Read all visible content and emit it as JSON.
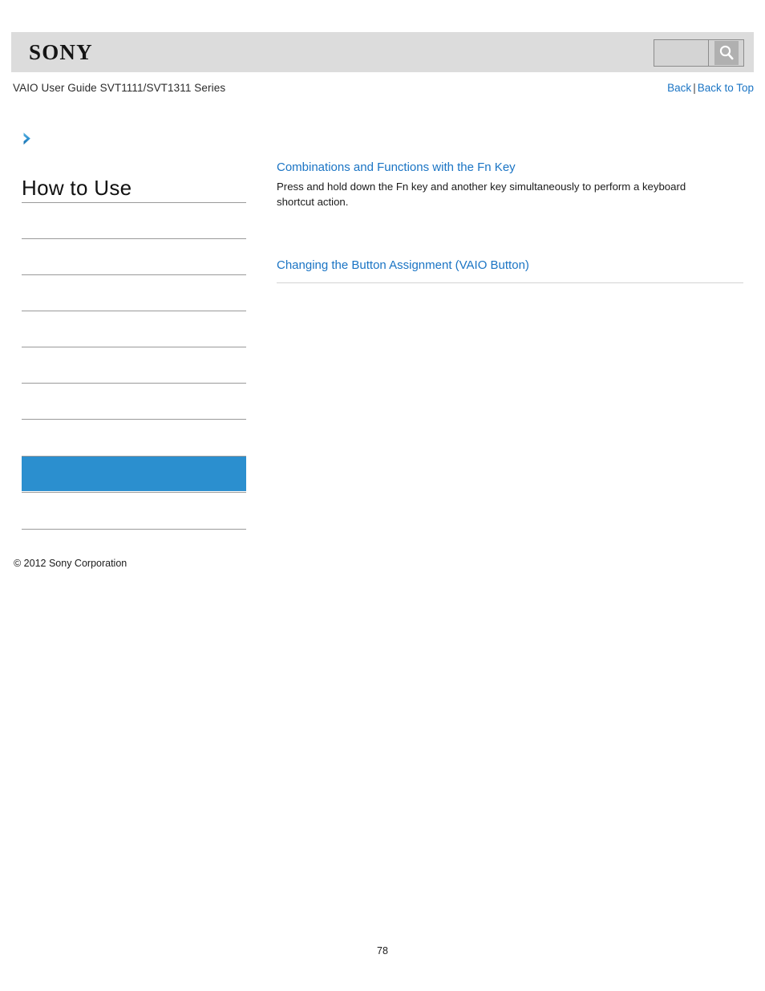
{
  "header": {
    "logo_text": "SONY",
    "search": {
      "value": "",
      "placeholder": "",
      "button_icon": "search-icon"
    }
  },
  "doc": {
    "title": "VAIO User Guide SVT1111/SVT1311 Series",
    "nav": {
      "back_label": "Back",
      "separator": "|",
      "back_to_top_label": "Back to Top"
    }
  },
  "sidebar": {
    "chevron_icon": "chevron-right-icon",
    "heading": "How to Use",
    "items": [
      {
        "label": "",
        "selected": false
      },
      {
        "label": "",
        "selected": false
      },
      {
        "label": "",
        "selected": false
      },
      {
        "label": "",
        "selected": false
      },
      {
        "label": "",
        "selected": false
      },
      {
        "label": "",
        "selected": false
      },
      {
        "label": "",
        "selected": true
      },
      {
        "label": "",
        "selected": false
      }
    ]
  },
  "main": {
    "entries": [
      {
        "title": "Combinations and Functions with the Fn Key",
        "description": "Press and hold down the Fn key and another key simultaneously to perform a keyboard shortcut action."
      },
      {
        "title": "Changing the Button Assignment (VAIO Button)",
        "description": ""
      }
    ]
  },
  "footer": {
    "copyright": "© 2012 Sony Corporation",
    "page_number": "78"
  },
  "colors": {
    "link": "#1a74c4",
    "accent": "#2b8fcf",
    "header_bg": "#dcdcdc",
    "rule": "#9a9a9a"
  }
}
